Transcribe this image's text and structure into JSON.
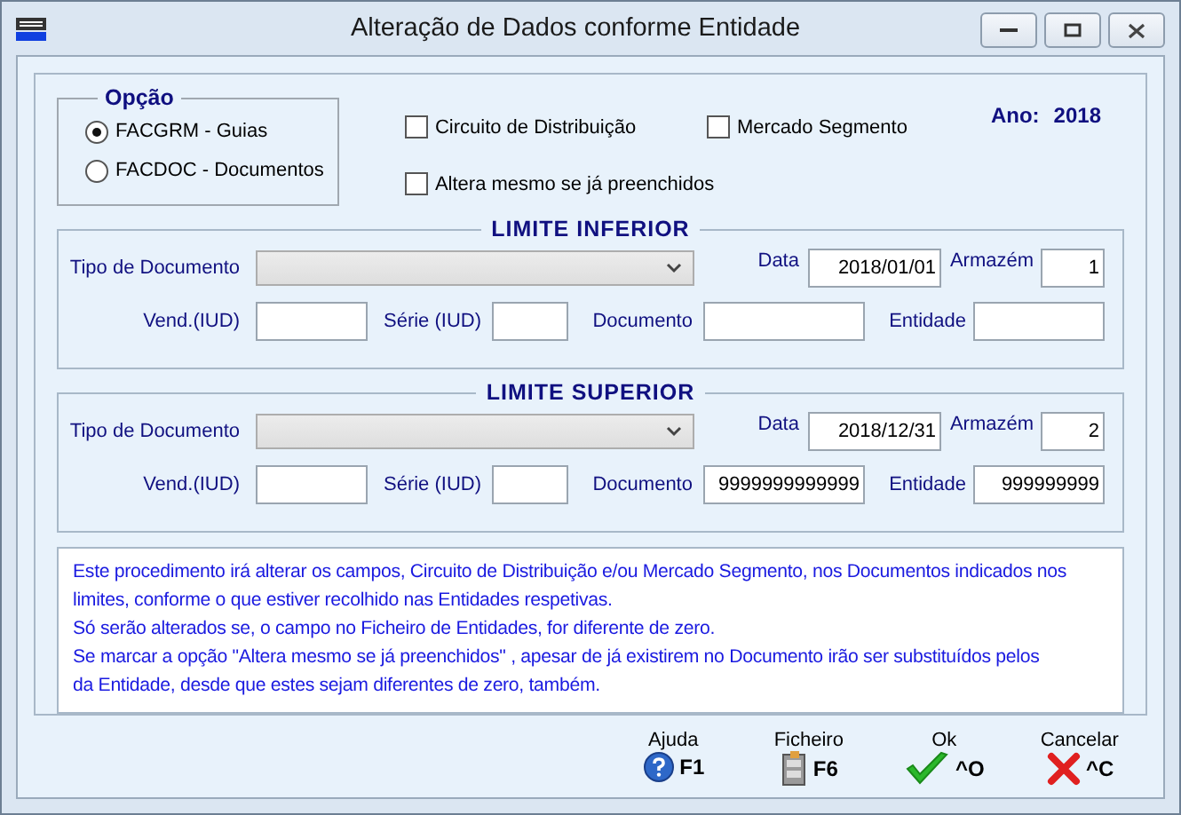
{
  "window": {
    "title": "Alteração de Dados conforme Entidade"
  },
  "option_group": {
    "title": "Opção",
    "options": [
      {
        "label": "FACGRM - Guias",
        "selected": true
      },
      {
        "label": "FACDOC - Documentos",
        "selected": false
      }
    ]
  },
  "year": {
    "label": "Ano:",
    "value": "2018"
  },
  "checkboxes": [
    {
      "label": "Circuito de Distribuição",
      "checked": false
    },
    {
      "label": "Mercado Segmento",
      "checked": false
    },
    {
      "label": "Altera mesmo se já preenchidos",
      "checked": false
    }
  ],
  "limits": [
    {
      "title": "LIMITE INFERIOR",
      "tipo_label": "Tipo de Documento",
      "data_label": "Data",
      "data": "2018/01/01",
      "armazem_label": "Armazém",
      "armazem": "1",
      "vend_label": "Vend.(IUD)",
      "serie_label": "Série (IUD)",
      "documento_label": "Documento",
      "entidade_label": "Entidade"
    },
    {
      "title": "LIMITE SUPERIOR",
      "tipo_label": "Tipo de Documento",
      "data_label": "Data",
      "data": "2018/12/31",
      "armazem_label": "Armazém",
      "armazem": "2",
      "vend_label": "Vend.(IUD)",
      "serie_label": "Série (IUD)",
      "documento_label": "Documento",
      "documento": "9999999999999",
      "entidade_label": "Entidade",
      "entidade": "999999999"
    }
  ],
  "info_lines": [
    "Este procedimento irá alterar os campos, Circuito de Distribuição e/ou Mercado Segmento, nos Documentos indicados nos",
    "limites, conforme o que estiver recolhido nas Entidades respetivas.",
    "Só serão alterados se, o campo no Ficheiro de Entidades,  for diferente de zero.",
    "Se marcar a opção \"Altera mesmo se já preenchidos\" , apesar de já existirem no Documento irão ser substituídos pelos",
    "da Entidade,  desde que estes sejam diferentes de zero, também."
  ],
  "buttons": [
    {
      "kind": "help",
      "label": "Ajuda",
      "shortcut": "F1"
    },
    {
      "kind": "file",
      "label": "Ficheiro",
      "shortcut": "F6"
    },
    {
      "kind": "ok",
      "label": "Ok",
      "shortcut": "^O"
    },
    {
      "kind": "cancel",
      "label": "Cancelar",
      "shortcut": "^C"
    }
  ]
}
